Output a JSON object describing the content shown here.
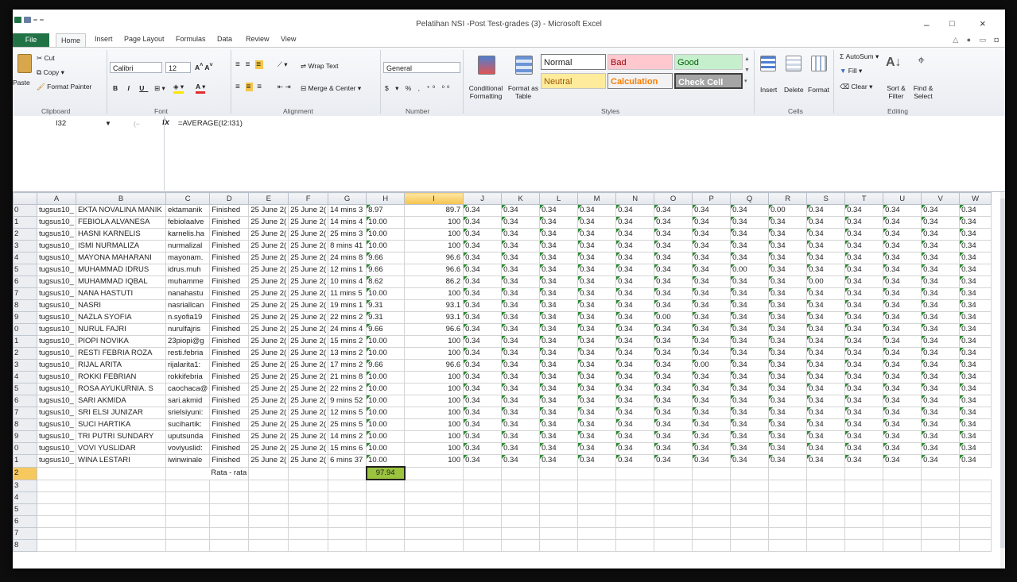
{
  "window": {
    "title": "Pelatihan NSI -Post Test-grades (3) - Microsoft Excel",
    "controls": [
      "–",
      "□",
      "×"
    ]
  },
  "tabs": [
    "File",
    "Home",
    "Insert",
    "Page Layout",
    "Formulas",
    "Data",
    "Review",
    "View"
  ],
  "ribbon": {
    "clipboard": {
      "paste": "Paste",
      "cut": "Cut",
      "copy": "Copy",
      "format_painter": "Format Painter",
      "label": "Clipboard"
    },
    "font": {
      "name": "Calibri",
      "size": "12",
      "label": "Font"
    },
    "alignment": {
      "wrap_text": "Wrap Text",
      "merge_center": "Merge & Center",
      "label": "Alignment"
    },
    "number": {
      "format": "General",
      "label": "Number"
    },
    "styles": {
      "conditional": "Conditional Formatting",
      "format_table": "Format as Table",
      "normal": "Normal",
      "bad": "Bad",
      "good": "Good",
      "neutral": "Neutral",
      "calculation": "Calculation",
      "check_cell": "Check Cell",
      "label": "Styles"
    },
    "cells": {
      "insert": "Insert",
      "delete": "Delete",
      "format": "Format",
      "label": "Cells"
    },
    "editing": {
      "autosum": "AutoSum",
      "fill": "Fill",
      "clear": "Clear",
      "sort_filter": "Sort & Filter",
      "find_select": "Find & Select",
      "label": "Editing"
    }
  },
  "formula_bar": {
    "cell": "I32",
    "fx": "fx",
    "formula": "=AVERAGE(I2:I31)"
  },
  "columns": [
    "A",
    "B",
    "C",
    "D",
    "E",
    "F",
    "G",
    "H",
    "I",
    "J",
    "K",
    "L",
    "M",
    "N",
    "O",
    "P",
    "Q",
    "R",
    "S",
    "T",
    "U",
    "V",
    "W"
  ],
  "rows": [
    {
      "r": "0",
      "a": "tugsus10_",
      "b": "EKTA NOVALINA MANIK",
      "c": "ektamanik",
      "d": "Finished",
      "e": "25 June 2(",
      "f": "25 June 2(",
      "g": "14 mins 3",
      "h": "8.97",
      "i": "89.7",
      "rest": [
        "0.34",
        "0.34",
        "0.34",
        "0.34",
        "0.34",
        "0.34",
        "0.34",
        "0.34",
        "0.00",
        "0.34",
        "0.34",
        "0.34",
        "0.34",
        "0.34"
      ]
    },
    {
      "r": "1",
      "a": "tugsus10_",
      "b": "FEBIOLA ALVANESA",
      "c": "febiolaalve",
      "d": "Finished",
      "e": "25 June 2(",
      "f": "25 June 2(",
      "g": "14 mins 4",
      "h": "10.00",
      "i": "100",
      "rest": [
        "0.34",
        "0.34",
        "0.34",
        "0.34",
        "0.34",
        "0.34",
        "0.34",
        "0.34",
        "0.34",
        "0.34",
        "0.34",
        "0.34",
        "0.34",
        "0.34"
      ]
    },
    {
      "r": "2",
      "a": "tugsus10_",
      "b": "HASNI KARNELIS",
      "c": "karnelis.ha",
      "d": "Finished",
      "e": "25 June 2(",
      "f": "25 June 2(",
      "g": "25 mins 3",
      "h": "10.00",
      "i": "100",
      "rest": [
        "0.34",
        "0.34",
        "0.34",
        "0.34",
        "0.34",
        "0.34",
        "0.34",
        "0.34",
        "0.34",
        "0.34",
        "0.34",
        "0.34",
        "0.34",
        "0.34"
      ]
    },
    {
      "r": "3",
      "a": "tugsus10_",
      "b": "ISMI NURMALIZA",
      "c": "nurmalizal",
      "d": "Finished",
      "e": "25 June 2(",
      "f": "25 June 2(",
      "g": "8 mins 41",
      "h": "10.00",
      "i": "100",
      "rest": [
        "0.34",
        "0.34",
        "0.34",
        "0.34",
        "0.34",
        "0.34",
        "0.34",
        "0.34",
        "0.34",
        "0.34",
        "0.34",
        "0.34",
        "0.34",
        "0.34"
      ]
    },
    {
      "r": "4",
      "a": "tugsus10_",
      "b": "MAYONA MAHARANI",
      "c": "mayonam.",
      "d": "Finished",
      "e": "25 June 2(",
      "f": "25 June 2(",
      "g": "24 mins 8",
      "h": "9.66",
      "i": "96.6",
      "rest": [
        "0.34",
        "0.34",
        "0.34",
        "0.34",
        "0.34",
        "0.34",
        "0.34",
        "0.34",
        "0.34",
        "0.34",
        "0.34",
        "0.34",
        "0.34",
        "0.34"
      ]
    },
    {
      "r": "5",
      "a": "tugsus10_",
      "b": "MUHAMMAD IDRUS",
      "c": "idrus.muh",
      "d": "Finished",
      "e": "25 June 2(",
      "f": "25 June 2(",
      "g": "12 mins 1",
      "h": "9.66",
      "i": "96.6",
      "rest": [
        "0.34",
        "0.34",
        "0.34",
        "0.34",
        "0.34",
        "0.34",
        "0.34",
        "0.00",
        "0.34",
        "0.34",
        "0.34",
        "0.34",
        "0.34",
        "0.34"
      ]
    },
    {
      "r": "6",
      "a": "tugsus10_",
      "b": "MUHAMMAD IQBAL",
      "c": "muhamme",
      "d": "Finished",
      "e": "25 June 2(",
      "f": "25 June 2(",
      "g": "10 mins 4",
      "h": "8.62",
      "i": "86.2",
      "rest": [
        "0.34",
        "0.34",
        "0.34",
        "0.34",
        "0.34",
        "0.34",
        "0.34",
        "0.34",
        "0.34",
        "0.00",
        "0.34",
        "0.34",
        "0.34",
        "0.34"
      ]
    },
    {
      "r": "7",
      "a": "tugsus10_",
      "b": "NANA HASTUTI",
      "c": "nanahastu",
      "d": "Finished",
      "e": "25 June 2(",
      "f": "25 June 2(",
      "g": "11 mins 5",
      "h": "10.00",
      "i": "100",
      "rest": [
        "0.34",
        "0.34",
        "0.34",
        "0.34",
        "0.34",
        "0.34",
        "0.34",
        "0.34",
        "0.34",
        "0.34",
        "0.34",
        "0.34",
        "0.34",
        "0.34"
      ]
    },
    {
      "r": "8",
      "a": "tugsus10_",
      "b": "NASRI",
      "c": "nasriallcan",
      "d": "Finished",
      "e": "25 June 2(",
      "f": "25 June 2(",
      "g": "19 mins 1",
      "h": "9.31",
      "i": "93.1",
      "rest": [
        "0.34",
        "0.34",
        "0.34",
        "0.34",
        "0.34",
        "0.34",
        "0.34",
        "0.34",
        "0.34",
        "0.34",
        "0.34",
        "0.34",
        "0.34",
        "0.34"
      ]
    },
    {
      "r": "9",
      "a": "tugsus10_",
      "b": "NAZLA SYOFIA",
      "c": "n.syofia19",
      "d": "Finished",
      "e": "25 June 2(",
      "f": "25 June 2(",
      "g": "22 mins 2",
      "h": "9.31",
      "i": "93.1",
      "rest": [
        "0.34",
        "0.34",
        "0.34",
        "0.34",
        "0.34",
        "0.00",
        "0.34",
        "0.34",
        "0.34",
        "0.34",
        "0.34",
        "0.34",
        "0.34",
        "0.34"
      ]
    },
    {
      "r": "0",
      "a": "tugsus10_",
      "b": "NURUL FAJRI",
      "c": "nurulfajris",
      "d": "Finished",
      "e": "25 June 2(",
      "f": "25 June 2(",
      "g": "24 mins 4",
      "h": "9.66",
      "i": "96.6",
      "rest": [
        "0.34",
        "0.34",
        "0.34",
        "0.34",
        "0.34",
        "0.34",
        "0.34",
        "0.34",
        "0.34",
        "0.34",
        "0.34",
        "0.34",
        "0.34",
        "0.34"
      ]
    },
    {
      "r": "1",
      "a": "tugsus10_",
      "b": "PIOPI NOVIKA",
      "c": "23piopi@g",
      "d": "Finished",
      "e": "25 June 2(",
      "f": "25 June 2(",
      "g": "15 mins 2",
      "h": "10.00",
      "i": "100",
      "rest": [
        "0.34",
        "0.34",
        "0.34",
        "0.34",
        "0.34",
        "0.34",
        "0.34",
        "0.34",
        "0.34",
        "0.34",
        "0.34",
        "0.34",
        "0.34",
        "0.34"
      ]
    },
    {
      "r": "2",
      "a": "tugsus10_",
      "b": "RESTI FEBRIA ROZA",
      "c": "resti.febria",
      "d": "Finished",
      "e": "25 June 2(",
      "f": "25 June 2(",
      "g": "13 mins 2",
      "h": "10.00",
      "i": "100",
      "rest": [
        "0.34",
        "0.34",
        "0.34",
        "0.34",
        "0.34",
        "0.34",
        "0.34",
        "0.34",
        "0.34",
        "0.34",
        "0.34",
        "0.34",
        "0.34",
        "0.34"
      ]
    },
    {
      "r": "3",
      "a": "tugsus10_",
      "b": "RIJAL ARITA",
      "c": "rijalarita1:",
      "d": "Finished",
      "e": "25 June 2(",
      "f": "25 June 2(",
      "g": "17 mins 2",
      "h": "9.66",
      "i": "96.6",
      "rest": [
        "0.34",
        "0.34",
        "0.34",
        "0.34",
        "0.34",
        "0.34",
        "0.00",
        "0.34",
        "0.34",
        "0.34",
        "0.34",
        "0.34",
        "0.34",
        "0.34"
      ]
    },
    {
      "r": "4",
      "a": "tugsus10_",
      "b": "ROKKI FEBRIAN",
      "c": "rokkifebria",
      "d": "Finished",
      "e": "25 June 2(",
      "f": "25 June 2(",
      "g": "21 mins 8",
      "h": "10.00",
      "i": "100",
      "rest": [
        "0.34",
        "0.34",
        "0.34",
        "0.34",
        "0.34",
        "0.34",
        "0.34",
        "0.34",
        "0.34",
        "0.34",
        "0.34",
        "0.34",
        "0.34",
        "0.34"
      ]
    },
    {
      "r": "5",
      "a": "tugsus10_",
      "b": "ROSA AYUKURNIA. S",
      "c": "caochaca@",
      "d": "Finished",
      "e": "25 June 2(",
      "f": "25 June 2(",
      "g": "22 mins 2",
      "h": "10.00",
      "i": "100",
      "rest": [
        "0.34",
        "0.34",
        "0.34",
        "0.34",
        "0.34",
        "0.34",
        "0.34",
        "0.34",
        "0.34",
        "0.34",
        "0.34",
        "0.34",
        "0.34",
        "0.34"
      ]
    },
    {
      "r": "6",
      "a": "tugsus10_",
      "b": "SARI AKMIDA",
      "c": "sari.akmid",
      "d": "Finished",
      "e": "25 June 2(",
      "f": "25 June 2(",
      "g": "9 mins 52",
      "h": "10.00",
      "i": "100",
      "rest": [
        "0.34",
        "0.34",
        "0.34",
        "0.34",
        "0.34",
        "0.34",
        "0.34",
        "0.34",
        "0.34",
        "0.34",
        "0.34",
        "0.34",
        "0.34",
        "0.34"
      ]
    },
    {
      "r": "7",
      "a": "tugsus10_",
      "b": "SRI ELSI JUNIZAR",
      "c": "srielsiyuni:",
      "d": "Finished",
      "e": "25 June 2(",
      "f": "25 June 2(",
      "g": "12 mins 5",
      "h": "10.00",
      "i": "100",
      "rest": [
        "0.34",
        "0.34",
        "0.34",
        "0.34",
        "0.34",
        "0.34",
        "0.34",
        "0.34",
        "0.34",
        "0.34",
        "0.34",
        "0.34",
        "0.34",
        "0.34"
      ]
    },
    {
      "r": "8",
      "a": "tugsus10_",
      "b": "SUCI HARTIKA",
      "c": "sucihartik:",
      "d": "Finished",
      "e": "25 June 2(",
      "f": "25 June 2(",
      "g": "25 mins 5",
      "h": "10.00",
      "i": "100",
      "rest": [
        "0.34",
        "0.34",
        "0.34",
        "0.34",
        "0.34",
        "0.34",
        "0.34",
        "0.34",
        "0.34",
        "0.34",
        "0.34",
        "0.34",
        "0.34",
        "0.34"
      ]
    },
    {
      "r": "9",
      "a": "tugsus10_",
      "b": "TRI PUTRI SUNDARY",
      "c": "uputsunda",
      "d": "Finished",
      "e": "25 June 2(",
      "f": "25 June 2(",
      "g": "14 mins 2",
      "h": "10.00",
      "i": "100",
      "rest": [
        "0.34",
        "0.34",
        "0.34",
        "0.34",
        "0.34",
        "0.34",
        "0.34",
        "0.34",
        "0.34",
        "0.34",
        "0.34",
        "0.34",
        "0.34",
        "0.34"
      ]
    },
    {
      "r": "0",
      "a": "tugsus10_",
      "b": "VOVI YUSLIDAR",
      "c": "voviyuslid:",
      "d": "Finished",
      "e": "25 June 2(",
      "f": "25 June 2(",
      "g": "15 mins 6",
      "h": "10.00",
      "i": "100",
      "rest": [
        "0.34",
        "0.34",
        "0.34",
        "0.34",
        "0.34",
        "0.34",
        "0.34",
        "0.34",
        "0.34",
        "0.34",
        "0.34",
        "0.34",
        "0.34",
        "0.34"
      ]
    },
    {
      "r": "1",
      "a": "tugsus10_",
      "b": "WINA LESTARI",
      "c": "iwinwinale",
      "d": "Finished",
      "e": "25 June 2(",
      "f": "25 June 2(",
      "g": "6 mins 37",
      "h": "10.00",
      "i": "100",
      "rest": [
        "0.34",
        "0.34",
        "0.34",
        "0.34",
        "0.34",
        "0.34",
        "0.34",
        "0.34",
        "0.34",
        "0.34",
        "0.34",
        "0.34",
        "0.34",
        "0.34"
      ]
    }
  ],
  "summary": {
    "r": "2",
    "label": "Rata - rata",
    "value": "97.94"
  },
  "empty_rows": [
    "3",
    "4",
    "5",
    "6",
    "7",
    "8"
  ]
}
